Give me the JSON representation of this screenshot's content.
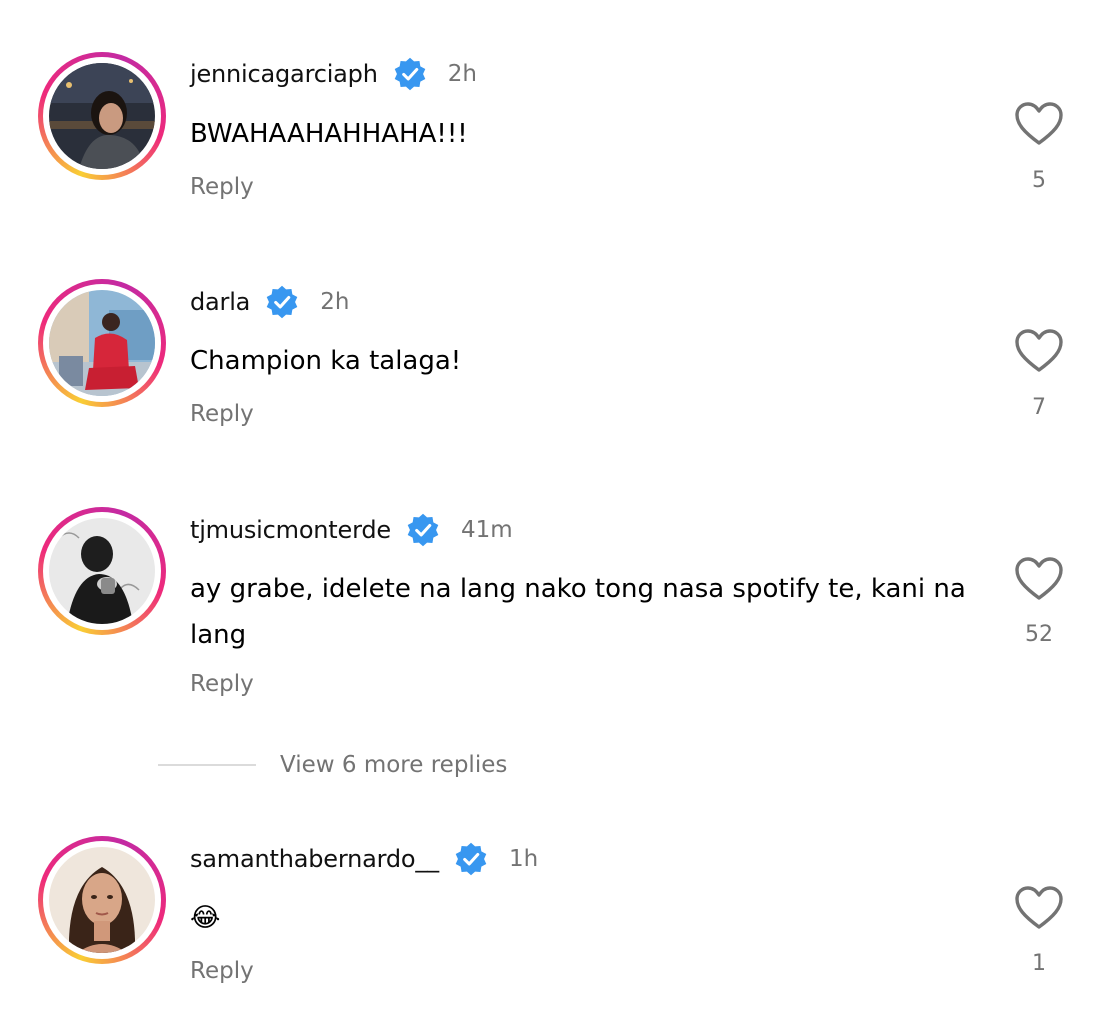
{
  "comments": [
    {
      "username": "jennicagarciaph",
      "verified": true,
      "time": "2h",
      "text": "BWAHAAHAHHAHA!!!",
      "reply_label": "Reply",
      "likes": "5",
      "avatar_icon": "profile-photo"
    },
    {
      "username": "darla",
      "verified": true,
      "time": "2h",
      "text": "Champion ka talaga!",
      "reply_label": "Reply",
      "likes": "7",
      "avatar_icon": "profile-photo"
    },
    {
      "username": "tjmusicmonterde",
      "verified": true,
      "time": "41m",
      "text": "ay grabe, idelete na lang nako tong nasa spotify te, kani na lang",
      "reply_label": "Reply",
      "likes": "52",
      "avatar_icon": "profile-photo"
    },
    {
      "username": "samanthabernardo__",
      "verified": true,
      "time": "1h",
      "text": "😂",
      "reply_label": "Reply",
      "likes": "1",
      "avatar_icon": "profile-photo"
    }
  ],
  "view_more": {
    "label": "View 6 more replies"
  },
  "colors": {
    "verified": "#3897f0",
    "secondary_text": "#737373",
    "story_ring_start": "#f9ce34",
    "story_ring_end": "#c32aa3"
  }
}
